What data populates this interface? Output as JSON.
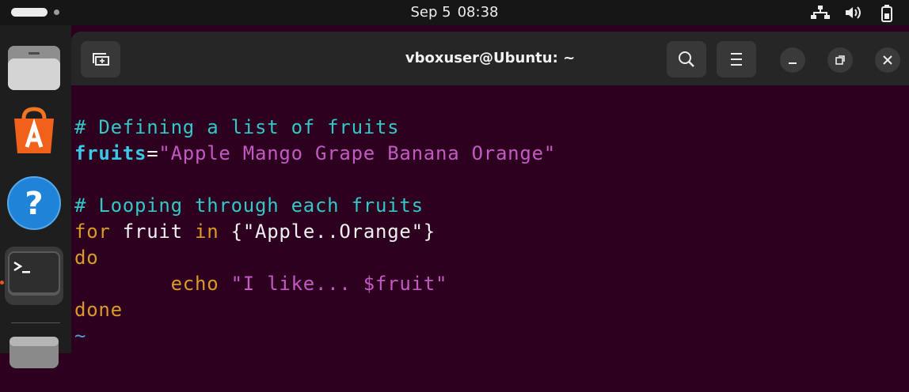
{
  "topbar": {
    "date": "Sep 5",
    "time": "08:38",
    "icons": [
      "activities-indicator",
      "network-icon",
      "volume-icon",
      "battery-icon"
    ]
  },
  "dock": {
    "items": [
      "files-icon",
      "app-center-icon",
      "help-icon",
      "terminal-icon",
      "disk-icon"
    ],
    "active": "terminal-icon",
    "accent": "#e95420"
  },
  "window": {
    "title": "vboxuser@Ubuntu: ~",
    "buttons": [
      "new-tab-icon",
      "search-icon",
      "menu-icon",
      "minimize-icon",
      "restore-icon",
      "close-icon"
    ]
  },
  "editor": {
    "comment1": "# Defining a list of fruits",
    "var_name": "fruits",
    "equals": "=",
    "var_value": "\"Apple Mango Grape Banana Orange\"",
    "comment2": "# Looping through each fruits",
    "for_kw": "for",
    "loop_var": " fruit ",
    "in_kw": "in",
    "brace_expr": " {\"Apple..Orange\"}",
    "do_kw": "do",
    "echo_kw": "echo",
    "echo_str": "\"I like... $fruit\"",
    "done_kw": "done",
    "tilde": "~",
    "colors": {
      "background": "#2c001e",
      "comment": "#34c7c7",
      "variable": "#3ac8e8",
      "string": "#c458c4",
      "keyword": "#d99a2b"
    }
  }
}
